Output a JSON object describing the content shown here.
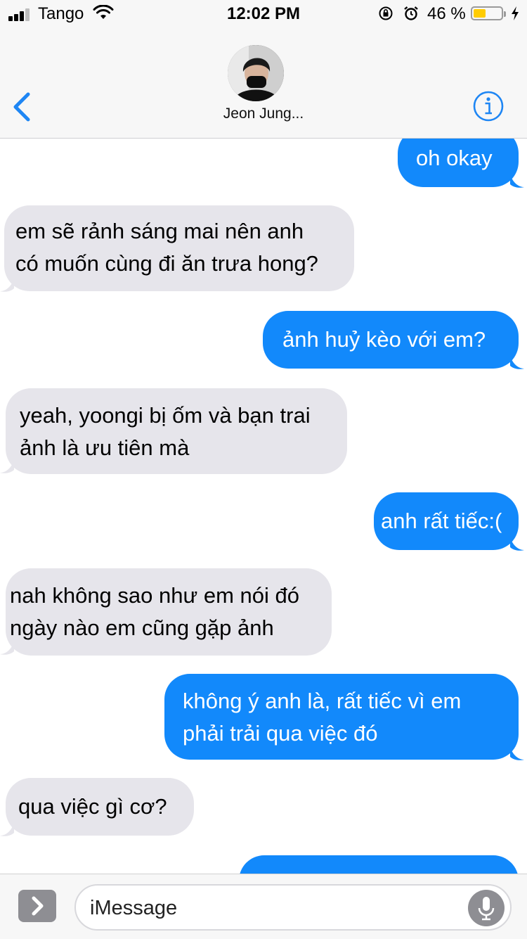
{
  "status": {
    "carrier": "Tango",
    "time": "12:02 PM",
    "battery_percent": "46 %",
    "battery_level": 0.46,
    "battery_color": "#ffcc00",
    "icons": [
      "signal-icon",
      "wifi-icon",
      "rotation-lock-icon",
      "alarm-icon",
      "battery-icon",
      "charging-bolt-icon"
    ]
  },
  "header": {
    "contact_name": "Jeon Jung...",
    "back_icon": "chevron-left-icon",
    "info_icon": "info-icon",
    "accent": "#1e86f4"
  },
  "messages": [
    {
      "direction": "out",
      "lines": [
        "oh okay"
      ]
    },
    {
      "direction": "in",
      "lines": [
        "em sẽ rảnh sáng mai nên anh",
        "có muốn cùng đi ăn trưa hong?"
      ]
    },
    {
      "direction": "out",
      "lines": [
        "ảnh huỷ kèo với em?"
      ]
    },
    {
      "direction": "in",
      "lines": [
        "yeah, yoongi bị ốm và bạn trai",
        "ảnh là ưu tiên mà"
      ]
    },
    {
      "direction": "out",
      "lines": [
        "anh rất tiếc:("
      ]
    },
    {
      "direction": "in",
      "lines": [
        "nah không sao như em nói đó",
        "ngày nào em cũng gặp ảnh"
      ]
    },
    {
      "direction": "out",
      "lines": [
        "không ý anh là, rất tiếc vì em",
        "phải trải qua việc đó"
      ]
    },
    {
      "direction": "in",
      "lines": [
        "qua việc gì cơ?"
      ]
    }
  ],
  "colors": {
    "outgoing_bubble": "#1289fb",
    "incoming_bubble": "#e6e5eb"
  },
  "input": {
    "placeholder": "iMessage",
    "value": "",
    "apps_icon": "app-store-icon",
    "mic_icon": "microphone-icon"
  }
}
